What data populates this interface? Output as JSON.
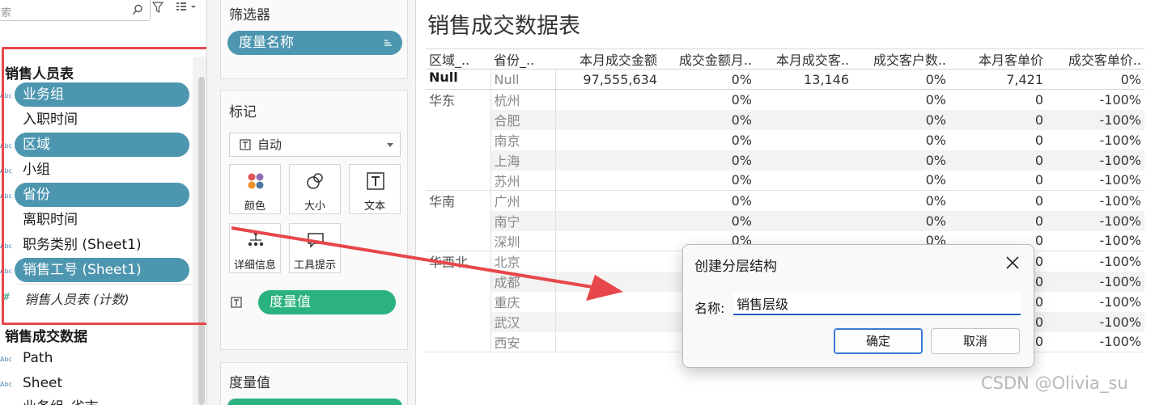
{
  "data_pane": {
    "search_partial": "索",
    "fields_group": {
      "title": "销售人员表",
      "items": [
        {
          "label": "业务组",
          "type": "Abc",
          "pill": true
        },
        {
          "label": "入职时间",
          "type": "",
          "pill": false
        },
        {
          "label": "区域",
          "type": "Abc",
          "pill": true
        },
        {
          "label": "小组",
          "type": "Abc",
          "pill": false
        },
        {
          "label": "省份",
          "type": "Abc",
          "pill": true
        },
        {
          "label": "离职时间",
          "type": "",
          "pill": false
        },
        {
          "label": "职务类别 (Sheet1)",
          "type": "Abc",
          "pill": false
        },
        {
          "label": "销售工号 (Sheet1)",
          "type": "Abc",
          "pill": true
        }
      ],
      "measure": "销售人员表 (计数)"
    },
    "second_group": {
      "title": "销售成交数据",
      "items": [
        {
          "label": "Path",
          "type": "Abc"
        },
        {
          "label": "Sheet",
          "type": "Abc"
        },
        {
          "label": "业务组_省市",
          "type": "Abc"
        }
      ]
    }
  },
  "shelves": {
    "filters": {
      "title": "筛选器",
      "pill": "度量名称"
    },
    "marks": {
      "title": "标记",
      "mark_type": "自动",
      "buttons": {
        "color": "颜色",
        "size": "大小",
        "text": "文本",
        "detail": "详细信息",
        "tooltip": "工具提示"
      },
      "value_pill": "度量值"
    },
    "measure_values": {
      "title": "度量值"
    }
  },
  "sheet": {
    "title": "销售成交数据表",
    "headers": [
      "区域_..",
      "省份_..",
      "本月成交金额",
      "成交金额月..",
      "本月成交客..",
      "成交客户数..",
      "本月客单价",
      "成交客单价.."
    ],
    "null_row": {
      "region": "Null",
      "province": "Null",
      "values": [
        "97,555,634",
        "0%",
        "13,146",
        "0%",
        "7,421",
        "0%"
      ]
    },
    "groups": [
      {
        "region": "华东",
        "rows": [
          {
            "province": "杭州",
            "values": [
              "",
              "0%",
              "",
              "0%",
              "0",
              "-100%"
            ]
          },
          {
            "province": "合肥",
            "values": [
              "",
              "0%",
              "",
              "0%",
              "0",
              "-100%"
            ]
          },
          {
            "province": "南京",
            "values": [
              "",
              "0%",
              "",
              "0%",
              "0",
              "-100%"
            ]
          },
          {
            "province": "上海",
            "values": [
              "",
              "0%",
              "",
              "0%",
              "0",
              "-100%"
            ]
          },
          {
            "province": "苏州",
            "values": [
              "",
              "0%",
              "",
              "0%",
              "0",
              "-100%"
            ]
          }
        ]
      },
      {
        "region": "华南",
        "rows": [
          {
            "province": "广州",
            "values": [
              "",
              "0%",
              "",
              "0%",
              "0",
              "-100%"
            ]
          },
          {
            "province": "南宁",
            "values": [
              "",
              "0%",
              "",
              "0%",
              "0",
              "-100%"
            ]
          },
          {
            "province": "深圳",
            "values": [
              "",
              "0%",
              "",
              "0%",
              "0",
              "-100%"
            ]
          }
        ]
      },
      {
        "region": "华西北",
        "rows": [
          {
            "province": "北京",
            "values": [
              "",
              "",
              "",
              "",
              "0",
              "-100%"
            ]
          },
          {
            "province": "成都",
            "values": [
              "",
              "",
              "",
              "",
              "0",
              "-100%"
            ]
          },
          {
            "province": "重庆",
            "values": [
              "",
              "",
              "",
              "",
              "0",
              "-100%"
            ]
          },
          {
            "province": "武汉",
            "values": [
              "",
              "",
              "",
              "",
              "0",
              "-100%"
            ]
          },
          {
            "province": "西安",
            "values": [
              "",
              "",
              "",
              "",
              "0",
              "-100%"
            ]
          }
        ]
      }
    ]
  },
  "dialog": {
    "title": "创建分层结构",
    "name_label": "名称:",
    "name_value": "销售层级",
    "ok": "确定",
    "cancel": "取消"
  },
  "watermark": "CSDN @Olivia_su",
  "colors": {
    "pill_blue": "#4d96b0",
    "pill_green": "#2cb27e",
    "annotation_red": "#e8474a",
    "focus_blue": "#1f5fbf"
  }
}
